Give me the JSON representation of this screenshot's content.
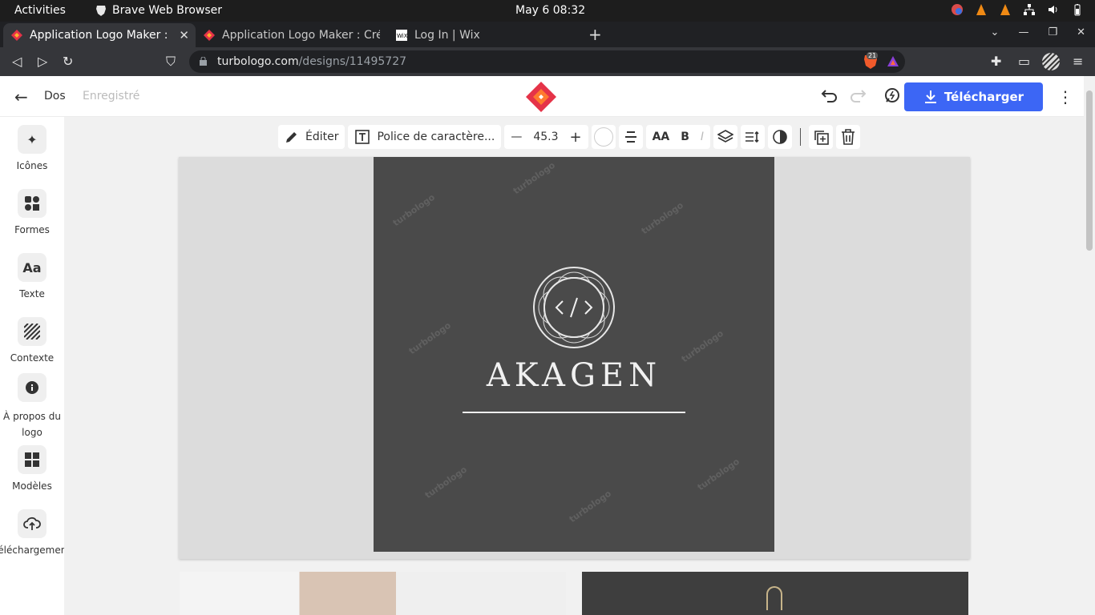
{
  "os": {
    "activities": "Activities",
    "app_name": "Brave Web Browser",
    "clock": "May 6  08:32"
  },
  "tabs": [
    {
      "title": "Application Logo Maker : C",
      "active": true
    },
    {
      "title": "Application Logo Maker : Crée",
      "active": false
    },
    {
      "title": "Log In | Wix",
      "active": false
    }
  ],
  "address": {
    "host": "turbologo.com",
    "path": "/designs/11495727",
    "shield_count": "21"
  },
  "header": {
    "back_label": "Dos",
    "status": "Enregistré",
    "download_label": "Télécharger",
    "accent": "#3c66f5"
  },
  "sidebar": {
    "items": [
      {
        "label": "Icônes",
        "icon": "sparkle-icon"
      },
      {
        "label": "Formes",
        "icon": "shapes-icon"
      },
      {
        "label": "Texte",
        "icon": "text-icon",
        "glyph": "Aa"
      },
      {
        "label": "Contexte",
        "icon": "background-icon"
      },
      {
        "label": "À propos du logo",
        "icon": "info-icon"
      },
      {
        "label": "Modèles",
        "icon": "templates-icon"
      },
      {
        "label": "Téléchargement",
        "icon": "upload-icon"
      }
    ]
  },
  "toolbar": {
    "edit_label": "Éditer",
    "font_label": "Police de caractère...",
    "font_size": "45.3",
    "case_label": "AA",
    "bold_label": "B",
    "italic_label": "I"
  },
  "canvas": {
    "brand_name": "AKAGEN",
    "emblem_glyph": "</>",
    "background_color": "#4a4a4a",
    "watermark": "turbologo"
  }
}
